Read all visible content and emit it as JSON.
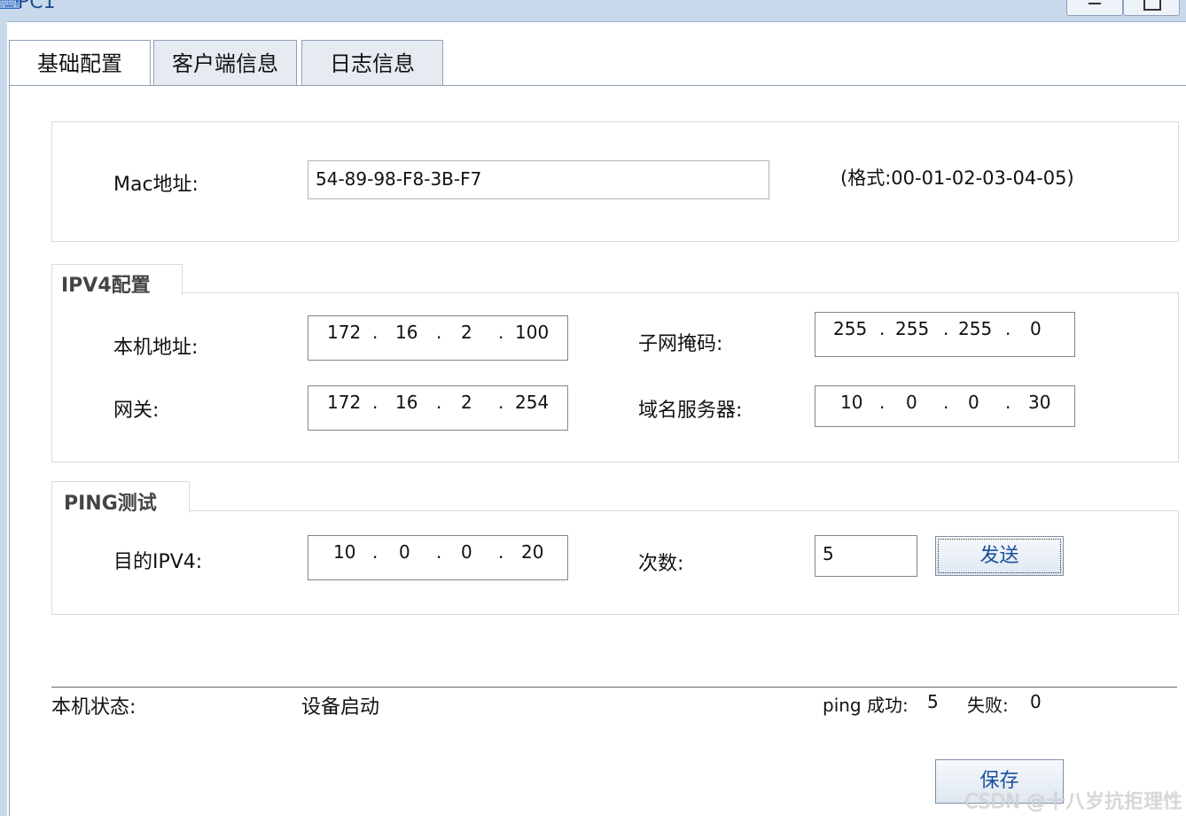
{
  "window": {
    "title": "PC1"
  },
  "tabs": [
    {
      "label": "基础配置"
    },
    {
      "label": "客户端信息"
    },
    {
      "label": "日志信息"
    }
  ],
  "mac": {
    "label": "Mac地址:",
    "value": "54-89-98-F8-3B-F7",
    "format_hint": "(格式:00-01-02-03-04-05)"
  },
  "ipv4": {
    "group_title": "IPV4配置",
    "host_label": "本机地址:",
    "host": [
      "172",
      "16",
      "2",
      "100"
    ],
    "mask_label": "子网掩码:",
    "mask": [
      "255",
      "255",
      "255",
      "0"
    ],
    "gateway_label": "网关:",
    "gateway": [
      "172",
      "16",
      "2",
      "254"
    ],
    "dns_label": "域名服务器:",
    "dns": [
      "10",
      "0",
      "0",
      "30"
    ]
  },
  "ping": {
    "group_title": "PING测试",
    "target_label": "目的IPV4:",
    "target": [
      "10",
      "0",
      "0",
      "20"
    ],
    "count_label": "次数:",
    "count": "5",
    "send_label": "发送"
  },
  "status": {
    "label": "本机状态:",
    "value": "设备启动",
    "ping_success_label": "ping 成功:",
    "ping_success": "5",
    "ping_fail_label": "失败:",
    "ping_fail": "0"
  },
  "save_label": "保存",
  "watermark": "CSDN @十八岁抗拒理性"
}
